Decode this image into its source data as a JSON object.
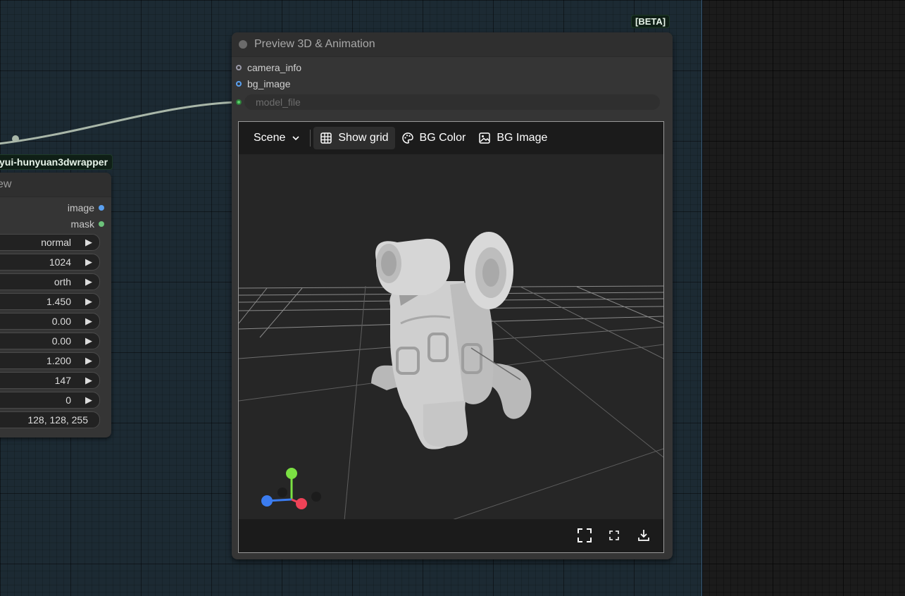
{
  "left_node": {
    "badge": "yui-hunyuan3dwrapper",
    "title": "ew",
    "outputs": [
      {
        "label": "image",
        "color": "#5aa0f0"
      },
      {
        "label": "mask",
        "color": "#6cc27a"
      }
    ],
    "widgets": [
      {
        "value": "normal"
      },
      {
        "value": "1024"
      },
      {
        "value": "orth"
      },
      {
        "value": "1.450"
      },
      {
        "value": "0.00"
      },
      {
        "value": "0.00"
      },
      {
        "value": "1.200"
      },
      {
        "value": "147"
      },
      {
        "value": "0"
      },
      {
        "value": "128, 128, 255"
      }
    ]
  },
  "main_node": {
    "badge": "[BETA]",
    "title": "Preview 3D & Animation",
    "inputs": [
      {
        "label": "camera_info",
        "color": "#9a9aa8"
      },
      {
        "label": "bg_image",
        "color": "#5aa0f0"
      }
    ],
    "model_file_placeholder": "model_file",
    "toolbar": {
      "scene": "Scene",
      "show_grid": "Show grid",
      "bg_color": "BG Color",
      "bg_image": "BG Image"
    },
    "bottom_icons": [
      "fullscreen-icon",
      "exit-fullscreen-icon",
      "download-icon"
    ],
    "axis_colors": {
      "x": "#ee4257",
      "y": "#7be043",
      "z": "#3b7cf0"
    }
  }
}
